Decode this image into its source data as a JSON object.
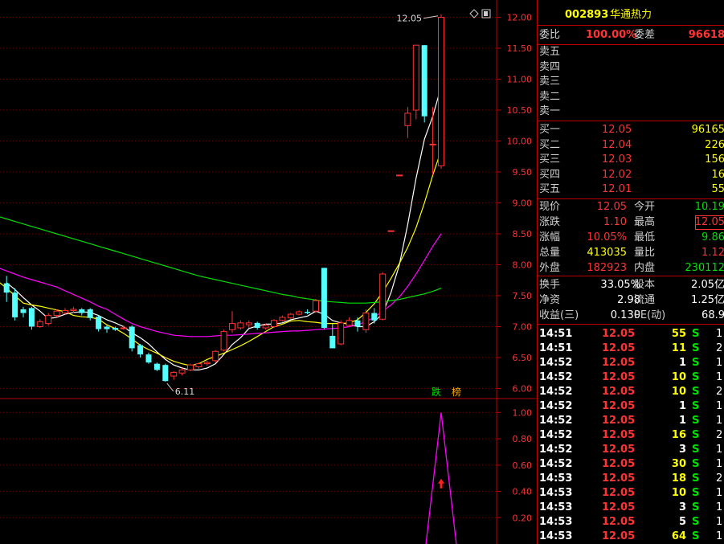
{
  "stock": {
    "code": "002893",
    "name": "华通热力"
  },
  "weibi": {
    "label": "委比",
    "value": "100.00%",
    "label2": "委差",
    "value2": "96618"
  },
  "asks": [
    {
      "label": "卖五",
      "price": "",
      "vol": ""
    },
    {
      "label": "卖四",
      "price": "",
      "vol": ""
    },
    {
      "label": "卖三",
      "price": "",
      "vol": ""
    },
    {
      "label": "卖二",
      "price": "",
      "vol": ""
    },
    {
      "label": "卖一",
      "price": "",
      "vol": ""
    }
  ],
  "bids": [
    {
      "label": "买一",
      "price": "12.05",
      "vol": "96165"
    },
    {
      "label": "买二",
      "price": "12.04",
      "vol": "226"
    },
    {
      "label": "买三",
      "price": "12.03",
      "vol": "156"
    },
    {
      "label": "买四",
      "price": "12.02",
      "vol": "16"
    },
    {
      "label": "买五",
      "price": "12.01",
      "vol": "55"
    }
  ],
  "quote": [
    {
      "l1": "现价",
      "v1": "12.05",
      "l2": "今开",
      "v2": "10.19",
      "c1": "red",
      "c2": "grn"
    },
    {
      "l1": "涨跌",
      "v1": "1.10",
      "l2": "最高",
      "v2": "12.05",
      "c1": "red",
      "c2": "red"
    },
    {
      "l1": "涨幅",
      "v1": "10.05%",
      "l2": "最低",
      "v2": "9.86",
      "c1": "red",
      "c2": "grn"
    },
    {
      "l1": "总量",
      "v1": "413035",
      "l2": "量比",
      "v2": "1.12",
      "c1": "yel",
      "c2": "red"
    },
    {
      "l1": "外盘",
      "v1": "182923",
      "l2": "内盘",
      "v2": "230112",
      "c1": "red",
      "c2": "grn"
    }
  ],
  "fundamentals": [
    {
      "l1": "换手",
      "v1": "33.05%",
      "l2": "股本",
      "v2": "2.05亿"
    },
    {
      "l1": "净资",
      "v1": "2.98",
      "l2": "流通",
      "v2": "1.25亿"
    },
    {
      "l1": "收益(三)",
      "v1": "0.130",
      "l2": "PE(动)",
      "v2": "68.9"
    }
  ],
  "trades": [
    {
      "time": "14:51",
      "price": "12.05",
      "vol": "55",
      "side": "S",
      "n": "1"
    },
    {
      "time": "14:51",
      "price": "12.05",
      "vol": "11",
      "side": "S",
      "n": "2"
    },
    {
      "time": "14:52",
      "price": "12.05",
      "vol": "1",
      "side": "S",
      "n": "1"
    },
    {
      "time": "14:52",
      "price": "12.05",
      "vol": "10",
      "side": "S",
      "n": "1"
    },
    {
      "time": "14:52",
      "price": "12.05",
      "vol": "10",
      "side": "S",
      "n": "2"
    },
    {
      "time": "14:52",
      "price": "12.05",
      "vol": "1",
      "side": "S",
      "n": "1"
    },
    {
      "time": "14:52",
      "price": "12.05",
      "vol": "1",
      "side": "S",
      "n": "1"
    },
    {
      "time": "14:52",
      "price": "12.05",
      "vol": "16",
      "side": "S",
      "n": "2"
    },
    {
      "time": "14:52",
      "price": "12.05",
      "vol": "3",
      "side": "S",
      "n": "1"
    },
    {
      "time": "14:52",
      "price": "12.05",
      "vol": "30",
      "side": "S",
      "n": "1"
    },
    {
      "time": "14:53",
      "price": "12.05",
      "vol": "18",
      "side": "S",
      "n": "2"
    },
    {
      "time": "14:53",
      "price": "12.05",
      "vol": "10",
      "side": "S",
      "n": "1"
    },
    {
      "time": "14:53",
      "price": "12.05",
      "vol": "3",
      "side": "S",
      "n": "1"
    },
    {
      "time": "14:53",
      "price": "12.05",
      "vol": "5",
      "side": "S",
      "n": "1"
    },
    {
      "time": "14:53",
      "price": "12.05",
      "vol": "64",
      "side": "S",
      "n": "1"
    }
  ],
  "chart_data": [
    {
      "type": "candlestick",
      "ylim": [
        5.85,
        12.15
      ],
      "y_ticks": [
        "12.00",
        "11.50",
        "11.00",
        "10.50",
        "10.00",
        "9.50",
        "9.00",
        "8.50",
        "8.00",
        "7.50",
        "7.00",
        "6.50",
        "6.00"
      ],
      "candles": [
        {
          "o": 7.7,
          "c": 7.55,
          "h": 7.82,
          "l": 7.4
        },
        {
          "o": 7.55,
          "c": 7.15,
          "h": 7.62,
          "l": 7.1
        },
        {
          "o": 7.28,
          "c": 7.22,
          "h": 7.32,
          "l": 7.15
        },
        {
          "o": 7.3,
          "c": 7.0,
          "h": 7.32,
          "l": 6.95
        },
        {
          "o": 7.0,
          "c": 7.08,
          "h": 7.12,
          "l": 6.98
        },
        {
          "o": 7.05,
          "c": 7.18,
          "h": 7.22,
          "l": 7.02
        },
        {
          "o": 7.18,
          "c": 7.25,
          "h": 7.28,
          "l": 7.15
        },
        {
          "o": 7.22,
          "c": 7.26,
          "h": 7.3,
          "l": 7.2
        },
        {
          "o": 7.26,
          "c": 7.28,
          "h": 7.32,
          "l": 7.22
        },
        {
          "o": 7.28,
          "c": 7.22,
          "h": 7.3,
          "l": 7.18
        },
        {
          "o": 7.28,
          "c": 7.14,
          "h": 7.3,
          "l": 7.1
        },
        {
          "o": 7.16,
          "c": 6.96,
          "h": 7.18,
          "l": 6.92
        },
        {
          "o": 7.0,
          "c": 6.96,
          "h": 7.02,
          "l": 6.9
        },
        {
          "o": 6.98,
          "c": 6.95,
          "h": 7.0,
          "l": 6.93
        },
        {
          "o": 6.98,
          "c": 6.98,
          "h": 7.02,
          "l": 6.95
        },
        {
          "o": 7.0,
          "c": 6.65,
          "h": 7.02,
          "l": 6.6
        },
        {
          "o": 6.7,
          "c": 6.55,
          "h": 6.72,
          "l": 6.5
        },
        {
          "o": 6.55,
          "c": 6.42,
          "h": 6.58,
          "l": 6.4
        },
        {
          "o": 6.4,
          "c": 6.3,
          "h": 6.42,
          "l": 6.28
        },
        {
          "o": 6.38,
          "c": 6.12,
          "h": 6.4,
          "l": 6.11
        },
        {
          "o": 6.2,
          "c": 6.26,
          "h": 6.28,
          "l": 6.14
        },
        {
          "o": 6.25,
          "c": 6.3,
          "h": 6.33,
          "l": 6.21
        },
        {
          "o": 6.3,
          "c": 6.38,
          "h": 6.4,
          "l": 6.28
        },
        {
          "o": 6.35,
          "c": 6.4,
          "h": 6.42,
          "l": 6.32
        },
        {
          "o": 6.4,
          "c": 6.42,
          "h": 6.45,
          "l": 6.37
        },
        {
          "o": 6.45,
          "c": 6.6,
          "h": 6.62,
          "l": 6.42
        },
        {
          "o": 6.62,
          "c": 6.92,
          "h": 6.95,
          "l": 6.6
        },
        {
          "o": 6.95,
          "c": 7.05,
          "h": 7.25,
          "l": 6.9
        },
        {
          "o": 6.98,
          "c": 7.06,
          "h": 7.1,
          "l": 6.95
        },
        {
          "o": 7.03,
          "c": 7.06,
          "h": 7.1,
          "l": 6.98
        },
        {
          "o": 7.06,
          "c": 6.98,
          "h": 7.08,
          "l": 6.95
        },
        {
          "o": 6.98,
          "c": 7.02,
          "h": 7.05,
          "l": 6.95
        },
        {
          "o": 7.0,
          "c": 7.1,
          "h": 7.12,
          "l": 6.98
        },
        {
          "o": 7.1,
          "c": 7.15,
          "h": 7.18,
          "l": 7.08
        },
        {
          "o": 7.14,
          "c": 7.2,
          "h": 7.22,
          "l": 7.12
        },
        {
          "o": 7.2,
          "c": 7.24,
          "h": 7.26,
          "l": 7.18
        },
        {
          "o": 7.24,
          "c": 7.22,
          "h": 7.28,
          "l": 7.2
        },
        {
          "o": 7.25,
          "c": 7.42,
          "h": 7.45,
          "l": 7.22
        },
        {
          "o": 7.95,
          "c": 6.98,
          "h": 7.95,
          "l": 6.95
        },
        {
          "o": 6.85,
          "c": 6.65,
          "h": 7.05,
          "l": 6.65
        },
        {
          "o": 6.72,
          "c": 7.06,
          "h": 7.1,
          "l": 6.7
        },
        {
          "o": 7.02,
          "c": 7.1,
          "h": 7.15,
          "l": 7.0
        },
        {
          "o": 7.1,
          "c": 7.0,
          "h": 7.15,
          "l": 6.92
        },
        {
          "o": 6.95,
          "c": 7.22,
          "h": 7.28,
          "l": 6.9
        },
        {
          "o": 7.22,
          "c": 7.1,
          "h": 7.3,
          "l": 7.05
        },
        {
          "o": 7.12,
          "c": 7.85,
          "h": 7.88,
          "l": 7.1
        },
        {
          "o": 8.55,
          "c": 8.55,
          "h": 8.55,
          "l": 8.55
        },
        {
          "o": 9.45,
          "c": 9.45,
          "h": 9.45,
          "l": 9.45
        },
        {
          "o": 10.25,
          "c": 10.45,
          "h": 10.55,
          "l": 10.05
        },
        {
          "o": 10.5,
          "c": 11.55,
          "h": 11.55,
          "l": 10.35
        },
        {
          "o": 11.55,
          "c": 10.4,
          "h": 11.55,
          "l": 10.3
        },
        {
          "o": 9.95,
          "c": 9.95,
          "h": 10.55,
          "l": 9.45
        },
        {
          "o": 9.6,
          "c": 12.0,
          "h": 12.05,
          "l": 9.55
        }
      ],
      "ma": [
        {
          "name": "MA5",
          "color": "#ffffff",
          "values": [
            7.71,
            7.6,
            7.47,
            7.35,
            7.25,
            7.13,
            7.15,
            7.2,
            7.23,
            7.24,
            7.23,
            7.18,
            7.11,
            7.06,
            7.0,
            6.9,
            6.82,
            6.72,
            6.59,
            6.47,
            6.38,
            6.33,
            6.3,
            6.3,
            6.33,
            6.4,
            6.55,
            6.71,
            6.82,
            6.97,
            7.01,
            7.04,
            7.04,
            7.06,
            7.11,
            7.14,
            7.17,
            7.25,
            7.2,
            7.1,
            7.06,
            7.04,
            7.0,
            7.0,
            7.08,
            7.21,
            7.55,
            8.0,
            8.65,
            9.4,
            10.03,
            10.4,
            10.88
          ]
        },
        {
          "name": "MA10",
          "color": "#ffff00",
          "values": [
            7.85,
            7.8,
            7.73,
            7.62,
            7.5,
            7.38,
            7.35,
            7.33,
            7.3,
            7.27,
            7.24,
            7.18,
            7.16,
            7.15,
            7.12,
            7.03,
            6.97,
            6.89,
            6.8,
            6.7,
            6.63,
            6.57,
            6.5,
            6.44,
            6.4,
            6.37,
            6.4,
            6.47,
            6.52,
            6.57,
            6.63,
            6.69,
            6.76,
            6.84,
            6.92,
            7.0,
            7.04,
            7.09,
            7.1,
            7.08,
            7.07,
            7.05,
            7.05,
            7.05,
            7.06,
            7.11,
            7.23,
            7.37,
            7.56,
            7.78,
            8.02,
            8.28,
            8.6,
            9.0,
            9.45,
            9.85
          ]
        },
        {
          "name": "MA20",
          "color": "#ff00ff",
          "values": [
            8.2,
            8.1,
            8.02,
            7.95,
            7.9,
            7.85,
            7.8,
            7.76,
            7.72,
            7.68,
            7.64,
            7.58,
            7.52,
            7.46,
            7.4,
            7.33,
            7.28,
            7.2,
            7.12,
            7.05,
            7.0,
            6.96,
            6.92,
            6.89,
            6.86,
            6.85,
            6.84,
            6.84,
            6.84,
            6.85,
            6.86,
            6.86,
            6.87,
            6.88,
            6.89,
            6.9,
            6.91,
            6.92,
            6.93,
            6.93,
            6.94,
            6.95,
            6.96,
            6.97,
            6.98,
            7.0,
            7.03,
            7.08,
            7.15,
            7.25,
            7.35,
            7.48,
            7.65,
            7.85,
            8.07,
            8.3,
            8.5
          ]
        },
        {
          "name": "MA60",
          "color": "#00e000",
          "values": [
            8.9,
            8.86,
            8.82,
            8.78,
            8.74,
            8.7,
            8.66,
            8.62,
            8.58,
            8.54,
            8.5,
            8.46,
            8.42,
            8.38,
            8.34,
            8.3,
            8.26,
            8.22,
            8.18,
            8.14,
            8.1,
            8.06,
            8.02,
            7.98,
            7.94,
            7.9,
            7.86,
            7.82,
            7.79,
            7.76,
            7.73,
            7.7,
            7.67,
            7.64,
            7.61,
            7.58,
            7.55,
            7.52,
            7.5,
            7.47,
            7.45,
            7.43,
            7.41,
            7.4,
            7.39,
            7.38,
            7.38,
            7.38,
            7.39,
            7.4,
            7.42,
            7.44,
            7.47,
            7.5,
            7.53,
            7.57,
            7.62
          ]
        }
      ],
      "annotations": [
        {
          "text": "12.05",
          "x_index": 52,
          "value": 12.05,
          "anchor": "end"
        },
        {
          "text": "6.11",
          "x_index": 19,
          "value": 6.11,
          "anchor": "start"
        }
      ],
      "badges": [
        "跌",
        "榜"
      ]
    },
    {
      "type": "line",
      "ylim": [
        0,
        1.1
      ],
      "y_ticks": [
        "1.00",
        "0.80",
        "0.60",
        "0.40",
        "0.20"
      ],
      "series": [
        {
          "x": [
            50,
            52,
            54
          ],
          "y": [
            -0.1,
            1.0,
            -0.1
          ]
        }
      ],
      "markers": [
        {
          "x_index": 52,
          "value": 0.46,
          "symbol": "arrow-up"
        }
      ]
    }
  ]
}
